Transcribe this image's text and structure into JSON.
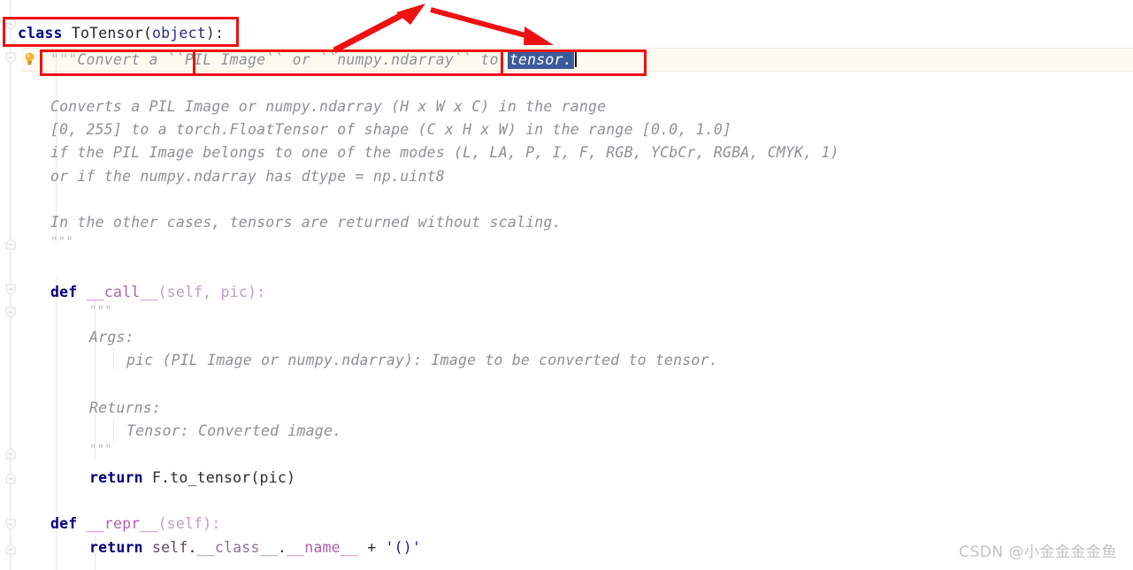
{
  "editor": {
    "language": "python",
    "background_color": "#ffffff",
    "current_line_highlight_color": "#fdfaf0",
    "selection_color": "#3c5a9a",
    "keyword_color": "#000080",
    "docstring_color": "#8e9095",
    "annotation_color": "#ee1111"
  },
  "gutter": {
    "bulb_icon": "lightbulb-icon",
    "fold_icons": [
      "fold-collapse-icon",
      "fold-collapse-icon",
      "fold-expand-icon",
      "fold-expand-icon",
      "fold-expand-icon",
      "fold-collapse-icon",
      "fold-collapse-icon",
      "fold-expand-icon",
      "fold-collapse-icon"
    ]
  },
  "code": {
    "class_line": {
      "keyword": "class",
      "name": "ToTensor",
      "open_paren": "(",
      "base": "object",
      "close": "):"
    },
    "docstring_open": {
      "quotes": "\"\"\"",
      "text_before": "Convert a ``",
      "inner": "PIL Image`` or ``numpy.ndarray",
      "text_after": "`` to ",
      "selected": "tensor."
    },
    "docstring_body": [
      "Converts a PIL Image or numpy.ndarray (H x W x C) in the range",
      "[0, 255] to a torch.FloatTensor of shape (C x H x W) in the range [0.0, 1.0]",
      "if the PIL Image belongs to one of the modes (L, LA, P, I, F, RGB, YCbCr, RGBA, CMYK, 1)",
      "or if the numpy.ndarray has dtype = np.uint8"
    ],
    "docstring_tail": "In the other cases, tensors are returned without scaling.",
    "docstring_close": "\"\"\"",
    "call_def": {
      "keyword": "def",
      "name": "__call__",
      "params": "(self, pic):"
    },
    "call_doc_open": "\"\"\"",
    "call_doc": {
      "args_label": "Args:",
      "args_text": "pic (PIL Image or numpy.ndarray): Image to be converted to tensor.",
      "returns_label": "Returns:",
      "returns_text": "Tensor: Converted image."
    },
    "call_doc_close": "\"\"\"",
    "call_return": {
      "keyword": "return",
      "expr": "F.to_tensor(pic)"
    },
    "repr_def": {
      "keyword": "def",
      "name": "__repr__",
      "params": "(self):"
    },
    "repr_return": {
      "keyword": "return",
      "obj": "self",
      "dot1": ".",
      "class_attr": "__class__",
      "dot2": ".",
      "name_attr": "__name__",
      "plus": " + ",
      "literal": "'()'"
    }
  },
  "annotations": {
    "box_class_label": "class ToTensor(object):",
    "box_docstring_label": "\"\"\"Convert a ``PIL Image`` or ``numpy.ndarray`` to tensor.",
    "box_inner_label": "PIL Image`` or ``numpy.ndarray",
    "arrow_left_label": "arrow pointing up-right",
    "arrow_right_label": "arrow pointing down-right to tensor."
  },
  "watermark": {
    "text": "CSDN @小金金金金鱼"
  }
}
